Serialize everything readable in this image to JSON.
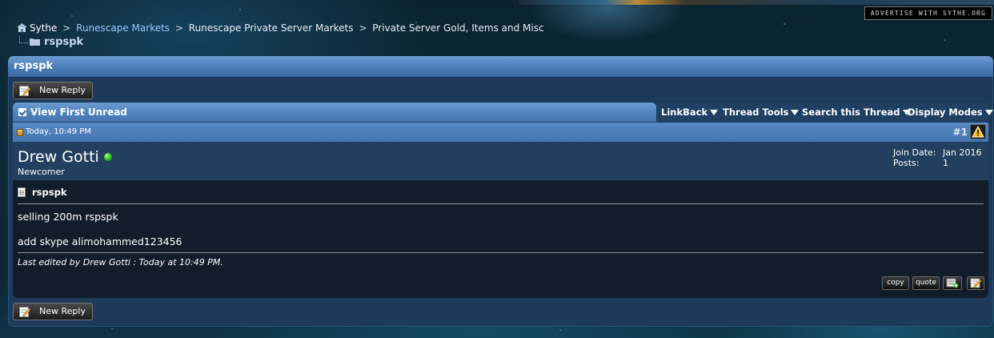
{
  "ad": {
    "label": "ADVERTISE WITH SYTHE.ORG"
  },
  "breadcrumb": {
    "items": [
      "Sythe",
      "Runescape Markets",
      "Runescape Private Server Markets",
      "Private Server Gold, Items and Misc"
    ],
    "separator": ">",
    "current": "rspspk"
  },
  "thread": {
    "title": "rspspk",
    "new_reply_label": "New Reply",
    "view_first_unread": "View First Unread",
    "menus": [
      "LinkBack",
      "Thread Tools",
      "Search this Thread",
      "Display Modes"
    ]
  },
  "post": {
    "date": "Today, 10:49 PM",
    "number": "#1",
    "username": "Drew Gotti",
    "user_title": "Newcomer",
    "join_date_label": "Join Date:",
    "join_date": "Jan 2016",
    "posts_label": "Posts:",
    "posts": "1",
    "title": "rspspk",
    "line1": "selling 200m rspspk",
    "line2": "add skype alimohammed123456",
    "edited": "Last edited by Drew Gotti : Today at 10:49 PM.",
    "copy_label": "copy",
    "quote_label": "quote"
  },
  "icons": {
    "home": "home-icon",
    "folder": "folder-icon",
    "online": "online-status-icon",
    "warn": "report-warning-icon"
  },
  "colors": {
    "link": "#9cc6ff",
    "header_blue": "#4b7cb7",
    "online_green": "#1eb81e"
  }
}
